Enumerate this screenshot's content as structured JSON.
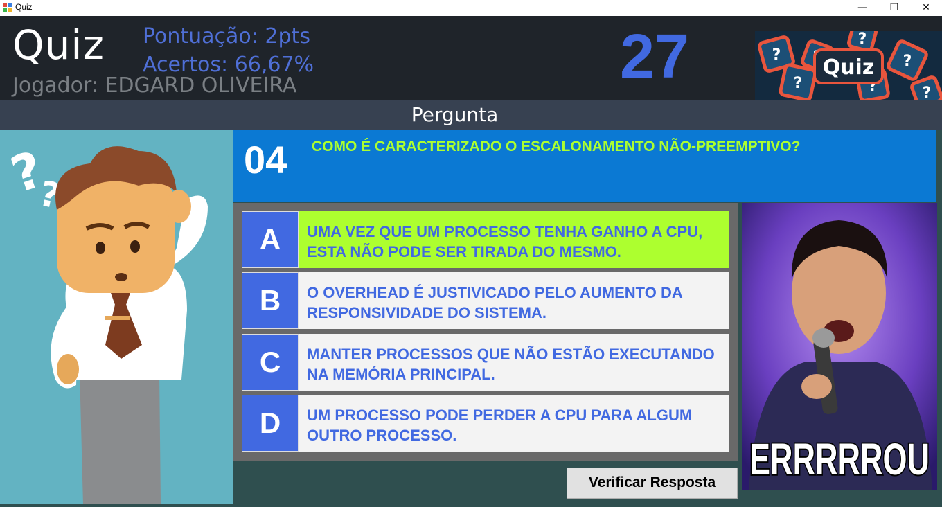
{
  "window": {
    "title": "Quiz",
    "controls": {
      "minimize": "—",
      "maximize": "❐",
      "close": "✕"
    }
  },
  "header": {
    "app_name": "Quiz",
    "score": "Pontuação: 2pts",
    "accuracy": "Acertos: 66,67%",
    "player": "Jogador: EDGARD OLIVEIRA",
    "timer": "27",
    "logo_text": "Quiz"
  },
  "section_title": "Pergunta",
  "question": {
    "number": "04",
    "text": "COMO É CARACTERIZADO O ESCALONAMENTO NÃO-PREEMPTIVO?"
  },
  "options": [
    {
      "letter": "A",
      "text": "UMA VEZ QUE UM PROCESSO TENHA GANHO A CPU, ESTA NÃO PODE SER TIRADA DO MESMO.",
      "selected": true
    },
    {
      "letter": "B",
      "text": "O OVERHEAD É JUSTIVICADO PELO AUMENTO DA RESPONSIVIDADE DO SISTEMA.",
      "selected": false
    },
    {
      "letter": "C",
      "text": "MANTER PROCESSOS QUE NÃO ESTÃO EXECUTANDO NA MEMÓRIA PRINCIPAL.",
      "selected": false
    },
    {
      "letter": "D",
      "text": "UM PROCESSO PODE PERDER A CPU PARA ALGUM OUTRO PROCESSO.",
      "selected": false
    }
  ],
  "verify_button": "Verificar Resposta",
  "reaction_image": {
    "caption": "ERRRRROU"
  },
  "colors": {
    "header_bg": "#1f242a",
    "accent_blue": "#4169e1",
    "question_bg": "#0b79d3",
    "highlight_green": "#adff2f",
    "left_pane_bg": "#63b3c2",
    "body_bg": "#2f4f4f"
  }
}
